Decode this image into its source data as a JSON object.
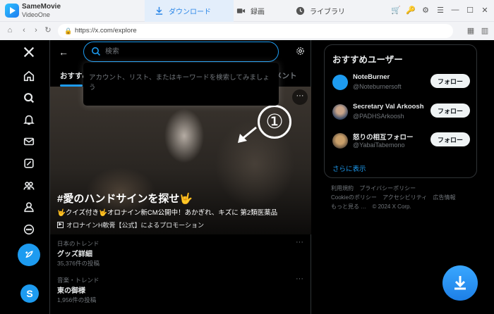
{
  "app": {
    "name": "SameMovie",
    "subtitle": "VideoOne"
  },
  "tabs": [
    {
      "label": "ダウンロード",
      "active": true
    },
    {
      "label": "録画",
      "active": false
    },
    {
      "label": "ライブラリ",
      "active": false
    }
  ],
  "address": {
    "url": "https://x.com/explore"
  },
  "search": {
    "placeholder": "検索",
    "dropdown_hint": "アカウント、リスト、またはキーワードを検索してみましょう"
  },
  "explore_tabs": {
    "first": "おすすめ",
    "last": "メント"
  },
  "hero": {
    "title": "#愛のハンドサインを探せ🤟",
    "description": "🤟クイズ付き🤟オロナイン新CM公開中！あかぎれ、キズに 第2類医薬品",
    "promo": "オロナインH軟膏【公式】によるプロモーション",
    "annotation": "①"
  },
  "trends": [
    {
      "category": "日本のトレンド",
      "name": "グッズ詳細",
      "count": "35,376件の投稿"
    },
    {
      "category": "音楽・トレンド",
      "name": "東の御様",
      "count": "1,956件の投稿"
    }
  ],
  "recommend": {
    "title": "おすすめユーザー",
    "users": [
      {
        "name": "NoteBurner",
        "handle": "@Noteburnersoft",
        "button": "フォロー"
      },
      {
        "name": "Secretary Val Arkoosh",
        "handle": "@PADHSArkoosh",
        "button": "フォロー"
      },
      {
        "name": "怒りの相互フォロー",
        "handle": "@YabaiTabemono",
        "button": "フォロー"
      }
    ],
    "more": "さらに表示"
  },
  "footer": {
    "links": [
      "利用規約",
      "プライバシーポリシー",
      "Cookieのポリシー",
      "アクセシビリティ",
      "広告情報",
      "もっと見る …",
      "© 2024 X Corp."
    ]
  },
  "colors": {
    "accent": "#1d9bf0",
    "app_accent": "#2b87e8"
  }
}
